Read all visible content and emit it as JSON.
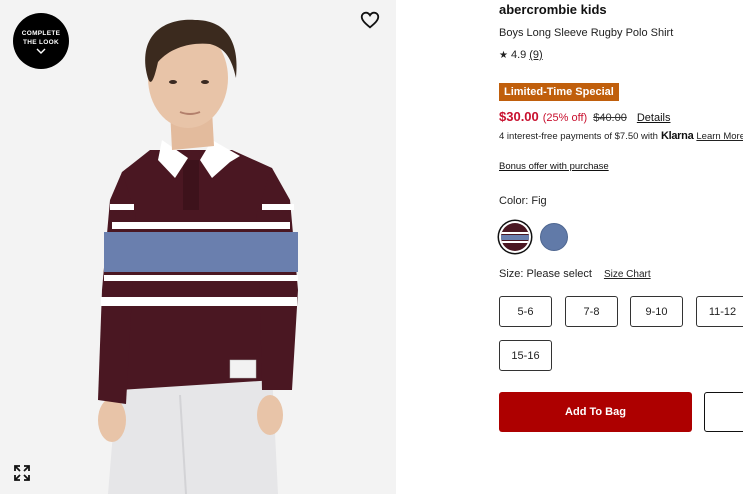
{
  "image": {
    "complete_look_line1": "COMPLETE",
    "complete_look_line2": "THE LOOK",
    "icons": {
      "wishlist": "heart-icon",
      "expand": "expand-icon",
      "complete_look_chevron": "chevron-down-icon"
    },
    "garment_colors": {
      "body": "#4a1722",
      "stripe_white": "#ffffff",
      "stripe_blue": "#6a7fae",
      "collar": "#ffffff"
    }
  },
  "product": {
    "brand": "abercrombie kids",
    "title": "Boys Long Sleeve Rugby Polo Shirt",
    "rating_star": "★",
    "rating": "4.9",
    "review_count": "(9)",
    "promo_badge": "Limited-Time Special",
    "price_now": "$30.00",
    "price_discount": "(25% off)",
    "price_was": "$40.00",
    "details_link": "Details",
    "klarna_text": "4 interest-free payments of $7.50 with",
    "klarna_logo": "Klarna",
    "klarna_learn": "Learn More",
    "bonus_offer": "Bonus offer with purchase",
    "color_label": "Color: Fig",
    "swatches": [
      {
        "name": "Fig",
        "selected": true
      },
      {
        "name": "Blue",
        "selected": false
      }
    ],
    "size_label": "Size: Please select",
    "size_chart": "Size Chart",
    "sizes": [
      "5-6",
      "7-8",
      "9-10",
      "11-12",
      "15-16"
    ],
    "add_to_bag": "Add To Bag"
  },
  "colors": {
    "accent_red": "#ad0000",
    "price_red": "#c8102e",
    "badge_orange": "#c05f0c"
  }
}
